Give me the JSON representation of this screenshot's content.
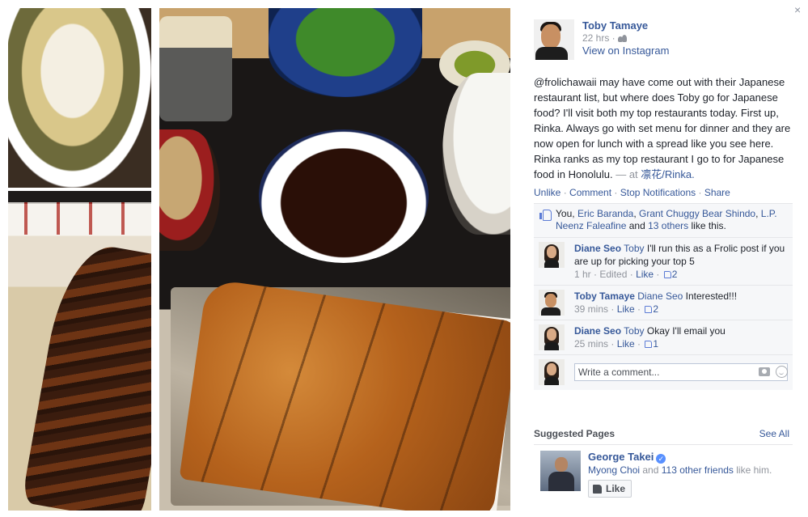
{
  "photos": [
    {
      "name": "udon-bowl"
    },
    {
      "name": "unagi-don"
    },
    {
      "name": "tonkatsu-set"
    }
  ],
  "close_glyph": "×",
  "post": {
    "author": "Toby Tamaye",
    "time": "22 hrs ·",
    "audience_icon": "friends-icon",
    "source": "View on Instagram",
    "text": "@frolichawaii may have come out with their Japanese restaurant list, but where does Toby go for Japanese food? I'll visit both my top restaurants today. First up, Rinka. Always go with set menu for dinner and they are now open for lunch with a spread like you see here. Rinka ranks as my top restaurant I go to for Japanese food in Honolulu.",
    "at_prefix": "— at",
    "location": "凛花/Rinka."
  },
  "actions": {
    "unlike": "Unlike",
    "comment": "Comment",
    "stop_notifications": "Stop Notifications",
    "share": "Share",
    "separator": "·"
  },
  "likes": {
    "you": "You,",
    "names": [
      "Eric Baranda",
      "Grant Chuggy Bear Shindo",
      "L.P. Neenz Faleafine"
    ],
    "and": "and",
    "others": "13 others",
    "suffix": "like this."
  },
  "comments": [
    {
      "author": "Diane Seo",
      "tag": "Toby",
      "text": "I'll run this as a Frolic post if you are up for picking your top 5",
      "time": "1 hr",
      "edited": "Edited",
      "like": "Like",
      "likes": "2"
    },
    {
      "author": "Toby Tamaye",
      "tag": "Diane Seo",
      "text": "Interested!!!",
      "time": "39 mins",
      "like": "Like",
      "likes": "2"
    },
    {
      "author": "Diane Seo",
      "tag": "Toby",
      "text": "Okay I'll email you",
      "time": "25 mins",
      "like": "Like",
      "likes": "1"
    }
  ],
  "composer": {
    "placeholder": "Write a comment..."
  },
  "suggested": {
    "title": "Suggested Pages",
    "see_all": "See All",
    "page": {
      "name": "George Takei",
      "verified_glyph": "✓",
      "friend": "Myong Choi",
      "and": "and",
      "others": "113 other friends",
      "suffix": "like him.",
      "button": "Like"
    }
  },
  "colors": {
    "link": "#365899",
    "meta": "#90949c",
    "panel": "#f6f7f9",
    "accent": "#5890ff"
  }
}
